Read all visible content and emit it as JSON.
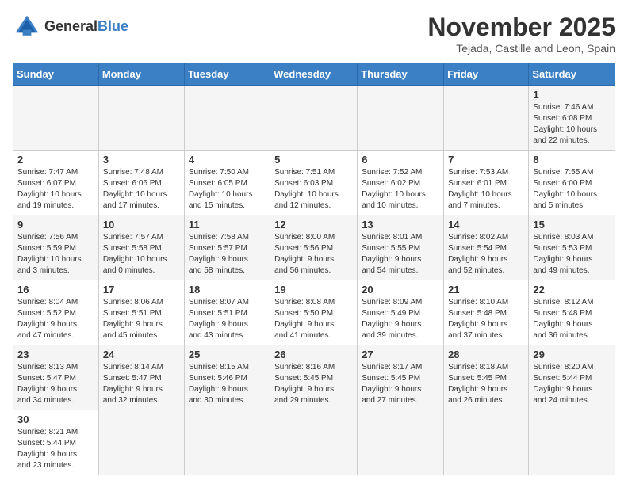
{
  "header": {
    "logo_general": "General",
    "logo_blue": "Blue",
    "month_title": "November 2025",
    "location": "Tejada, Castille and Leon, Spain"
  },
  "weekdays": [
    "Sunday",
    "Monday",
    "Tuesday",
    "Wednesday",
    "Thursday",
    "Friday",
    "Saturday"
  ],
  "weeks": [
    [
      {
        "day": "",
        "info": ""
      },
      {
        "day": "",
        "info": ""
      },
      {
        "day": "",
        "info": ""
      },
      {
        "day": "",
        "info": ""
      },
      {
        "day": "",
        "info": ""
      },
      {
        "day": "",
        "info": ""
      },
      {
        "day": "1",
        "info": "Sunrise: 7:46 AM\nSunset: 6:08 PM\nDaylight: 10 hours\nand 22 minutes."
      }
    ],
    [
      {
        "day": "2",
        "info": "Sunrise: 7:47 AM\nSunset: 6:07 PM\nDaylight: 10 hours\nand 19 minutes."
      },
      {
        "day": "3",
        "info": "Sunrise: 7:48 AM\nSunset: 6:06 PM\nDaylight: 10 hours\nand 17 minutes."
      },
      {
        "day": "4",
        "info": "Sunrise: 7:50 AM\nSunset: 6:05 PM\nDaylight: 10 hours\nand 15 minutes."
      },
      {
        "day": "5",
        "info": "Sunrise: 7:51 AM\nSunset: 6:03 PM\nDaylight: 10 hours\nand 12 minutes."
      },
      {
        "day": "6",
        "info": "Sunrise: 7:52 AM\nSunset: 6:02 PM\nDaylight: 10 hours\nand 10 minutes."
      },
      {
        "day": "7",
        "info": "Sunrise: 7:53 AM\nSunset: 6:01 PM\nDaylight: 10 hours\nand 7 minutes."
      },
      {
        "day": "8",
        "info": "Sunrise: 7:55 AM\nSunset: 6:00 PM\nDaylight: 10 hours\nand 5 minutes."
      }
    ],
    [
      {
        "day": "9",
        "info": "Sunrise: 7:56 AM\nSunset: 5:59 PM\nDaylight: 10 hours\nand 3 minutes."
      },
      {
        "day": "10",
        "info": "Sunrise: 7:57 AM\nSunset: 5:58 PM\nDaylight: 10 hours\nand 0 minutes."
      },
      {
        "day": "11",
        "info": "Sunrise: 7:58 AM\nSunset: 5:57 PM\nDaylight: 9 hours\nand 58 minutes."
      },
      {
        "day": "12",
        "info": "Sunrise: 8:00 AM\nSunset: 5:56 PM\nDaylight: 9 hours\nand 56 minutes."
      },
      {
        "day": "13",
        "info": "Sunrise: 8:01 AM\nSunset: 5:55 PM\nDaylight: 9 hours\nand 54 minutes."
      },
      {
        "day": "14",
        "info": "Sunrise: 8:02 AM\nSunset: 5:54 PM\nDaylight: 9 hours\nand 52 minutes."
      },
      {
        "day": "15",
        "info": "Sunrise: 8:03 AM\nSunset: 5:53 PM\nDaylight: 9 hours\nand 49 minutes."
      }
    ],
    [
      {
        "day": "16",
        "info": "Sunrise: 8:04 AM\nSunset: 5:52 PM\nDaylight: 9 hours\nand 47 minutes."
      },
      {
        "day": "17",
        "info": "Sunrise: 8:06 AM\nSunset: 5:51 PM\nDaylight: 9 hours\nand 45 minutes."
      },
      {
        "day": "18",
        "info": "Sunrise: 8:07 AM\nSunset: 5:51 PM\nDaylight: 9 hours\nand 43 minutes."
      },
      {
        "day": "19",
        "info": "Sunrise: 8:08 AM\nSunset: 5:50 PM\nDaylight: 9 hours\nand 41 minutes."
      },
      {
        "day": "20",
        "info": "Sunrise: 8:09 AM\nSunset: 5:49 PM\nDaylight: 9 hours\nand 39 minutes."
      },
      {
        "day": "21",
        "info": "Sunrise: 8:10 AM\nSunset: 5:48 PM\nDaylight: 9 hours\nand 37 minutes."
      },
      {
        "day": "22",
        "info": "Sunrise: 8:12 AM\nSunset: 5:48 PM\nDaylight: 9 hours\nand 36 minutes."
      }
    ],
    [
      {
        "day": "23",
        "info": "Sunrise: 8:13 AM\nSunset: 5:47 PM\nDaylight: 9 hours\nand 34 minutes."
      },
      {
        "day": "24",
        "info": "Sunrise: 8:14 AM\nSunset: 5:47 PM\nDaylight: 9 hours\nand 32 minutes."
      },
      {
        "day": "25",
        "info": "Sunrise: 8:15 AM\nSunset: 5:46 PM\nDaylight: 9 hours\nand 30 minutes."
      },
      {
        "day": "26",
        "info": "Sunrise: 8:16 AM\nSunset: 5:45 PM\nDaylight: 9 hours\nand 29 minutes."
      },
      {
        "day": "27",
        "info": "Sunrise: 8:17 AM\nSunset: 5:45 PM\nDaylight: 9 hours\nand 27 minutes."
      },
      {
        "day": "28",
        "info": "Sunrise: 8:18 AM\nSunset: 5:45 PM\nDaylight: 9 hours\nand 26 minutes."
      },
      {
        "day": "29",
        "info": "Sunrise: 8:20 AM\nSunset: 5:44 PM\nDaylight: 9 hours\nand 24 minutes."
      }
    ],
    [
      {
        "day": "30",
        "info": "Sunrise: 8:21 AM\nSunset: 5:44 PM\nDaylight: 9 hours\nand 23 minutes."
      },
      {
        "day": "",
        "info": ""
      },
      {
        "day": "",
        "info": ""
      },
      {
        "day": "",
        "info": ""
      },
      {
        "day": "",
        "info": ""
      },
      {
        "day": "",
        "info": ""
      },
      {
        "day": "",
        "info": ""
      }
    ]
  ]
}
